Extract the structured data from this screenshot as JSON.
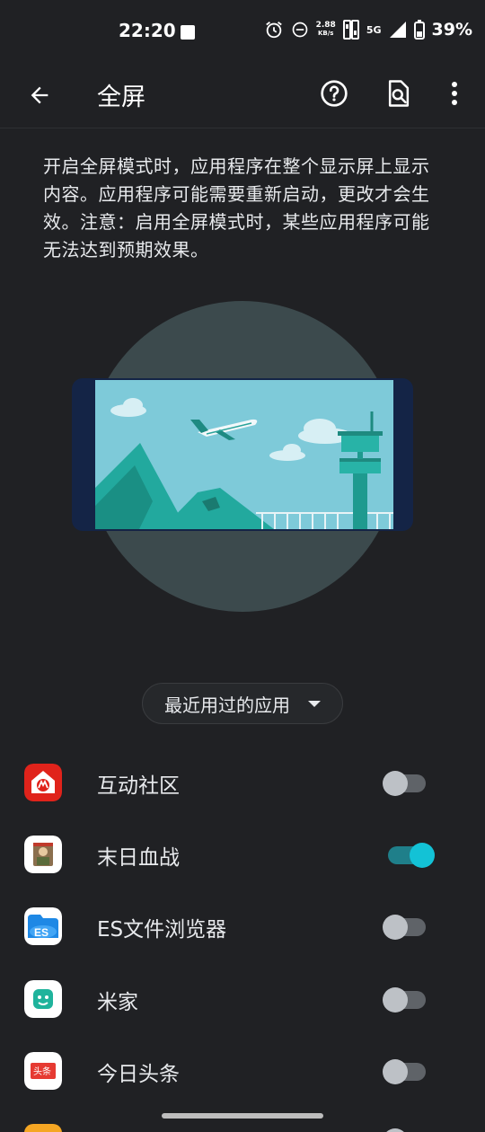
{
  "status": {
    "time": "22:20",
    "net_speed_value": "2.88",
    "net_speed_unit": "KB/s",
    "network": "5G",
    "battery": "39%",
    "icons": [
      "alarm-icon",
      "dnd-icon",
      "sim-icon",
      "signal-icon",
      "battery-icon"
    ]
  },
  "app_bar": {
    "title": "全屏",
    "icons": [
      "back-arrow-icon",
      "help-icon",
      "search-icon",
      "more-vert-icon"
    ]
  },
  "description": "开启全屏模式时，应用程序在整个显示屏上显示内容。应用程序可能需要重新启动，更改才会生效。注意：启用全屏模式时，某些应用程序可能无法达到预期效果。",
  "filter": {
    "selected": "最近用过的应用"
  },
  "apps": [
    {
      "name": "互动社区",
      "enabled": false,
      "icon": "motorola-community-icon"
    },
    {
      "name": "末日血战",
      "enabled": true,
      "icon": "game-icon"
    },
    {
      "name": "ES文件浏览器",
      "enabled": false,
      "icon": "es-file-explorer-icon"
    },
    {
      "name": "米家",
      "enabled": false,
      "icon": "mijia-icon"
    },
    {
      "name": "今日头条",
      "enabled": false,
      "icon": "toutiao-icon"
    }
  ],
  "colors": {
    "background": "#202124",
    "accent": "#13c2d6",
    "illustration_sky": "#7ecad9",
    "illustration_circle": "#3c4a4d",
    "phone_frame": "#142446"
  }
}
